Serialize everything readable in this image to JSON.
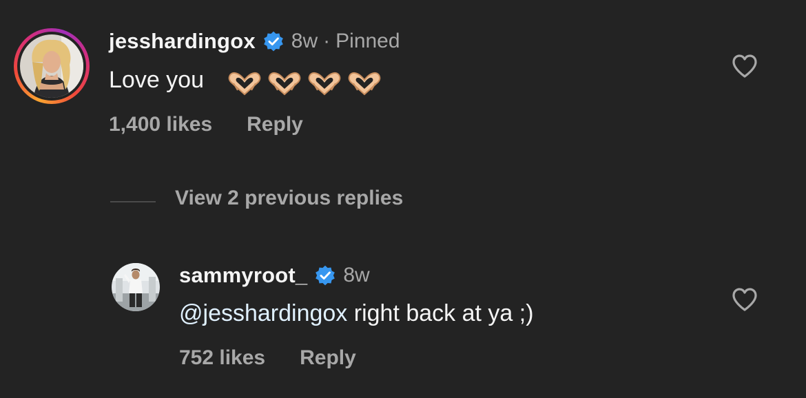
{
  "comments": [
    {
      "username": "jesshardingox",
      "time": "8w",
      "pinned_label": "Pinned",
      "text": "Love you",
      "emoji_count": 4,
      "emoji_name": "heart-hands",
      "likes": "1,400 likes",
      "reply_label": "Reply"
    }
  ],
  "thread": {
    "view_replies_label": "View 2 previous replies"
  },
  "replies": [
    {
      "username": "sammyroot_",
      "time": "8w",
      "mention": "@jesshardingox",
      "text": "right back at ya ;)",
      "likes": "752 likes",
      "reply_label": "Reply"
    }
  ],
  "colors": {
    "background": "#232323",
    "primary_text": "#f5f5f5",
    "secondary_text": "#a8a8a8",
    "verified": "#3797f0",
    "mention": "#e0f1ff"
  },
  "icons": {
    "verified": "verified-badge-icon",
    "like": "heart-outline-icon"
  }
}
